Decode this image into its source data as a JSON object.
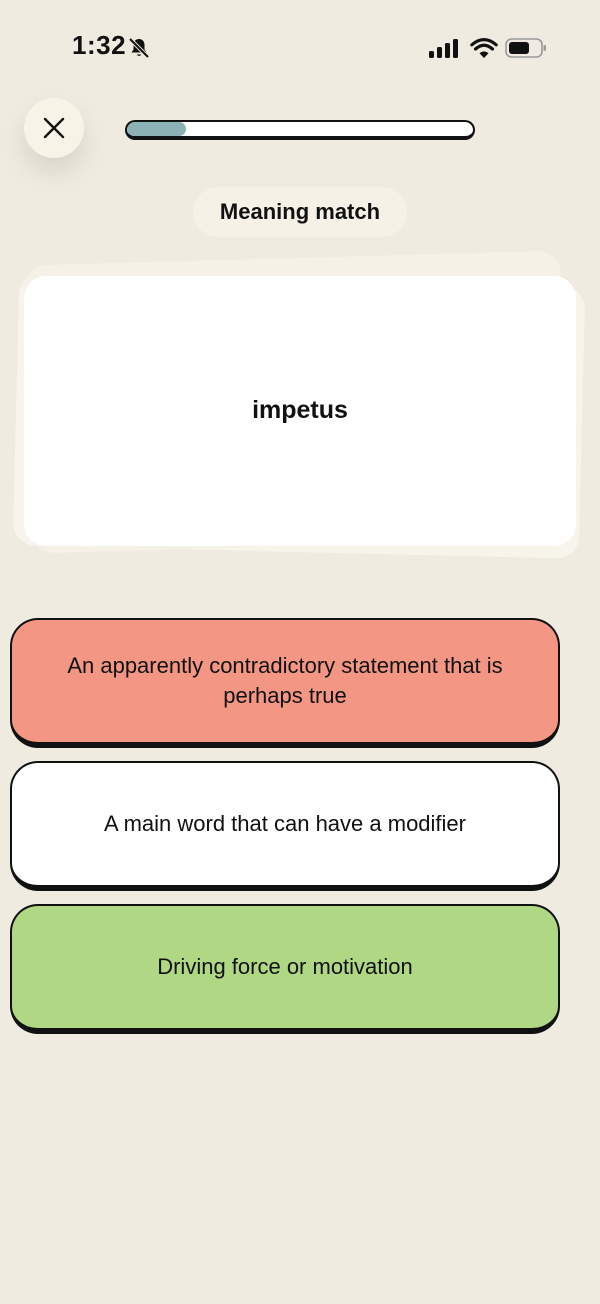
{
  "status_bar": {
    "time": "1:32",
    "icons": [
      "bell-slash-icon",
      "cellular-signal-icon",
      "wifi-icon",
      "battery-icon"
    ]
  },
  "header": {
    "close_icon": "close-icon",
    "progress_fraction": 0.17,
    "mode_label": "Meaning match"
  },
  "card": {
    "word": "impetus"
  },
  "options": [
    {
      "text": "An apparently contradictory statement that is perhaps true",
      "state": "incorrect",
      "color": "#f39683"
    },
    {
      "text": "A main word that can have a modifier",
      "state": "neutral",
      "color": "#ffffff"
    },
    {
      "text": "Driving force or motivation",
      "state": "correct",
      "color": "#b0d784"
    }
  ],
  "colors": {
    "background": "#efebe1",
    "progress_fill": "#8cb2b6",
    "incorrect": "#f39683",
    "correct": "#b0d784"
  }
}
